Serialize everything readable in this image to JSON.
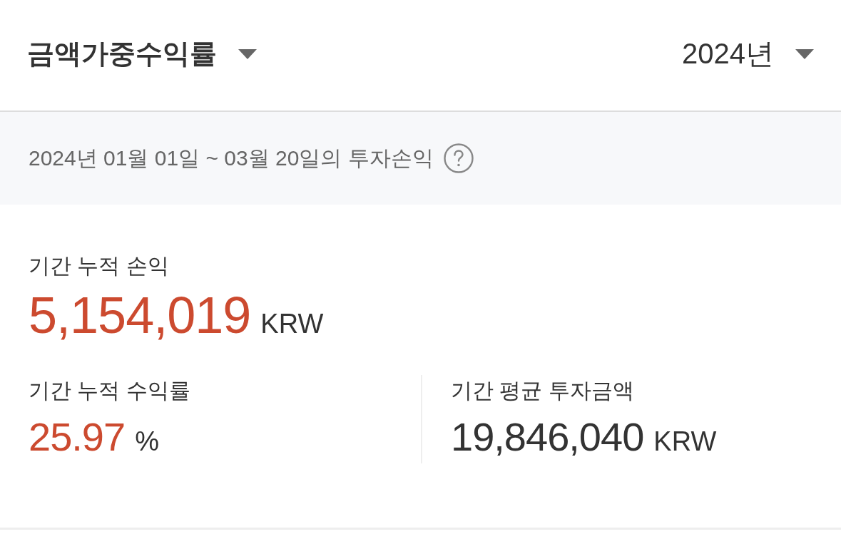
{
  "header": {
    "metric_selector": {
      "label": "금액가중수익률"
    },
    "year_selector": {
      "label": "2024년"
    }
  },
  "period": {
    "text": "2024년 01월 01일 ~ 03월 20일의 투자손익"
  },
  "headline": {
    "label": "기간 누적 손익",
    "value": "5,154,019",
    "unit": "KRW",
    "kind": "gain"
  },
  "stats": [
    {
      "label": "기간 누적 수익률",
      "value": "25.97",
      "unit": "%",
      "kind": "gain"
    },
    {
      "label": "기간 평균 투자금액",
      "value": "19,846,040",
      "unit": "KRW",
      "kind": "neutral"
    }
  ]
}
